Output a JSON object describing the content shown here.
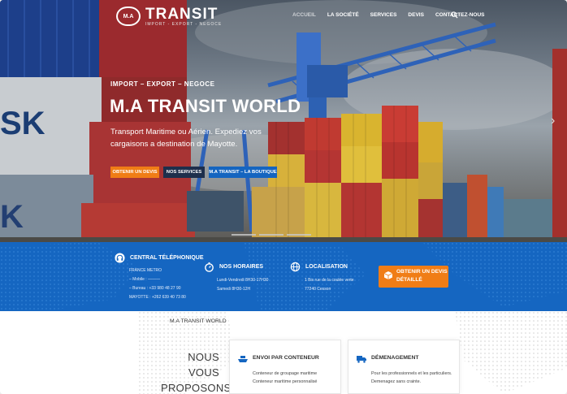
{
  "brand": {
    "badge_text": "M.A",
    "name": "TRANSIT",
    "tagline": "IMPORT - EXPORT - NEGOCE"
  },
  "nav": {
    "items": [
      "ACCUEIL",
      "LA SOCIÉTÉ",
      "SERVICES",
      "DEVIS",
      "CONTACTEZ-NOUS"
    ],
    "active_index": 0,
    "search_icon": "search-icon"
  },
  "hero": {
    "kicker": "IMPORT – EXPORT – NEGOCE",
    "title": "M.A TRANSIT WORLD",
    "text": "Transport Maritime ou Aérien. Expediez vos cargaisons a destination de Mayotte.",
    "buttons": {
      "quote": "OBTENIR UN DEVIS",
      "services": "NOS SERVICES",
      "shop": "M.A TRANSIT – LA BOUTIQUE"
    },
    "slides": 3
  },
  "infobar": {
    "phone": {
      "icon": "phone-headset-icon",
      "title": "CENTRAL TÉLÉPHONIQUE",
      "lines": [
        "FRANCE METRO",
        "– Mobile : ———",
        "– Bureau : +33 980 48 27 90",
        "MAYOTTE : +262 639 40 73 80"
      ]
    },
    "hours": {
      "icon": "stopwatch-icon",
      "title": "NOS HORAIRES",
      "lines": [
        "Lundi-Vendredi 8H30-17H30",
        "Samedi 8H30-12H"
      ]
    },
    "location": {
      "icon": "globe-icon",
      "title": "LOCALISATION",
      "lines": [
        "1 Bis rue de la coulée verte",
        "77240 Cesson"
      ]
    },
    "cta": {
      "icon": "cube-icon",
      "line1": "OBTENIR UN DEVIS",
      "line2": "DÉTAILLÉ"
    },
    "colors": {
      "bar": "#1566c1",
      "accent": "#f07d16"
    }
  },
  "proposals": {
    "kicker": "M.A TRANSIT WORLD",
    "title_line1": "NOUS VOUS",
    "title_line2": "PROPOSONS",
    "cards": [
      {
        "icon": "ship-icon",
        "title": "ENVOI PAR CONTENEUR",
        "lines": [
          "Conteneur de groupage maritime",
          "Conteneur maritime personnalisé"
        ]
      },
      {
        "icon": "moving-truck-icon",
        "title": "DÉMENAGEMENT",
        "lines": [
          "Pour les professionnels et les particuliers.",
          "Demenagez sans crainte."
        ]
      }
    ]
  }
}
